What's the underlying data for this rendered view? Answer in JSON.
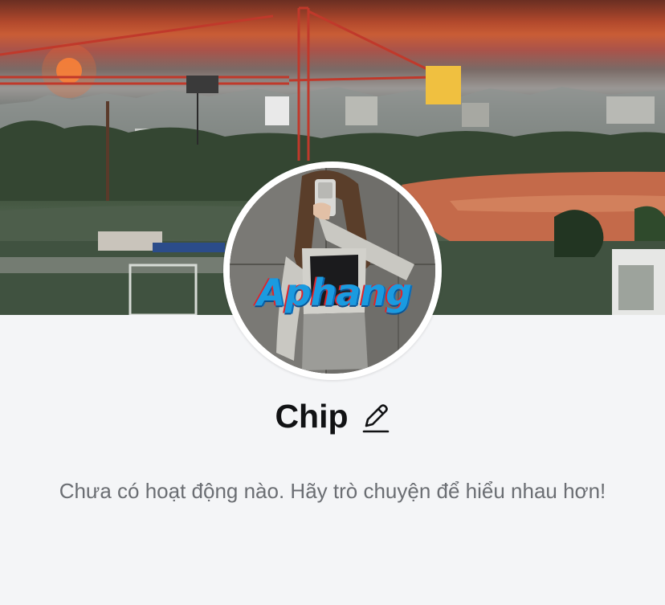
{
  "profile": {
    "name": "Chip",
    "bio_empty": "Chưa có hoạt động nào. Hãy trò chuyện để hiểu nhau hơn!",
    "avatar_watermark": "Aphang"
  },
  "icons": {
    "edit": "pencil-icon"
  },
  "colors": {
    "page_bg": "#f4f5f7",
    "name_text": "#111214",
    "bio_text": "#6b6e73",
    "sunset": "#c95d36"
  }
}
